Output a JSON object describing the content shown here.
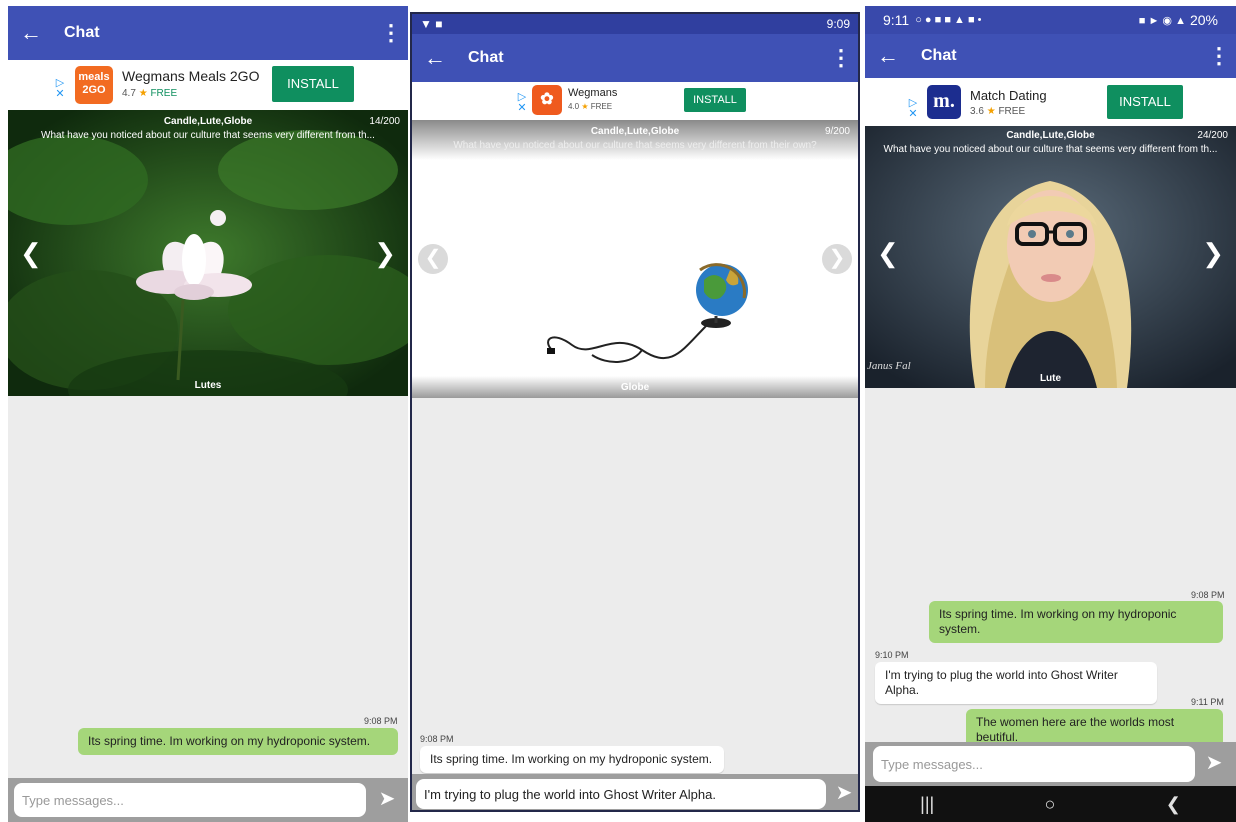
{
  "screen1": {
    "appbar": {
      "title": "Chat"
    },
    "ad": {
      "icon_text": "meals 2GO",
      "app_name": "Wegmans Meals 2GO",
      "rating": "4.7",
      "price": "FREE",
      "install_label": "INSTALL"
    },
    "carousel": {
      "topic": "Candle,Lute,Globe",
      "counter": "14/200",
      "question": "What have you noticed about our culture that seems very different from th...",
      "caption": "Lutes"
    },
    "messages": [
      {
        "time": "9:08 PM",
        "text": "Its spring time.  Im working on my hydroponic system."
      }
    ],
    "input": {
      "placeholder": "Type messages..."
    }
  },
  "screen2": {
    "status": {
      "time": "9:09"
    },
    "appbar": {
      "title": "Chat"
    },
    "ad": {
      "app_name": "Wegmans",
      "rating": "4.0",
      "price": "FREE",
      "install_label": "INSTALL"
    },
    "carousel": {
      "topic": "Candle,Lute,Globe",
      "counter": "9/200",
      "question": "What have you noticed about our culture that seems very different from their own?",
      "caption": "Globe"
    },
    "messages": [
      {
        "time": "9:08 PM",
        "text": "Its spring time.  Im working on my hydroponic system."
      }
    ],
    "input": {
      "value": "I'm trying to plug the world into Ghost Writer Alpha."
    }
  },
  "screen3": {
    "status": {
      "time": "9:11",
      "battery": "20%"
    },
    "appbar": {
      "title": "Chat"
    },
    "ad": {
      "icon_text": "m.",
      "app_name": "Match Dating",
      "rating": "3.6",
      "price": "FREE",
      "install_label": "INSTALL"
    },
    "carousel": {
      "topic": "Candle,Lute,Globe",
      "counter": "24/200",
      "question": "What have you noticed about our culture that seems very different from th...",
      "caption": "Lute",
      "watermark": "Janus Fal"
    },
    "messages": [
      {
        "time": "9:08 PM",
        "text": "Its spring time.  Im working on my hydroponic system."
      },
      {
        "time": "9:10 PM",
        "text": "I'm trying to plug the world into Ghost Writer Alpha."
      },
      {
        "time": "9:11 PM",
        "text": "The women here are the worlds most beutiful."
      }
    ],
    "input": {
      "placeholder": "Type messages..."
    }
  }
}
